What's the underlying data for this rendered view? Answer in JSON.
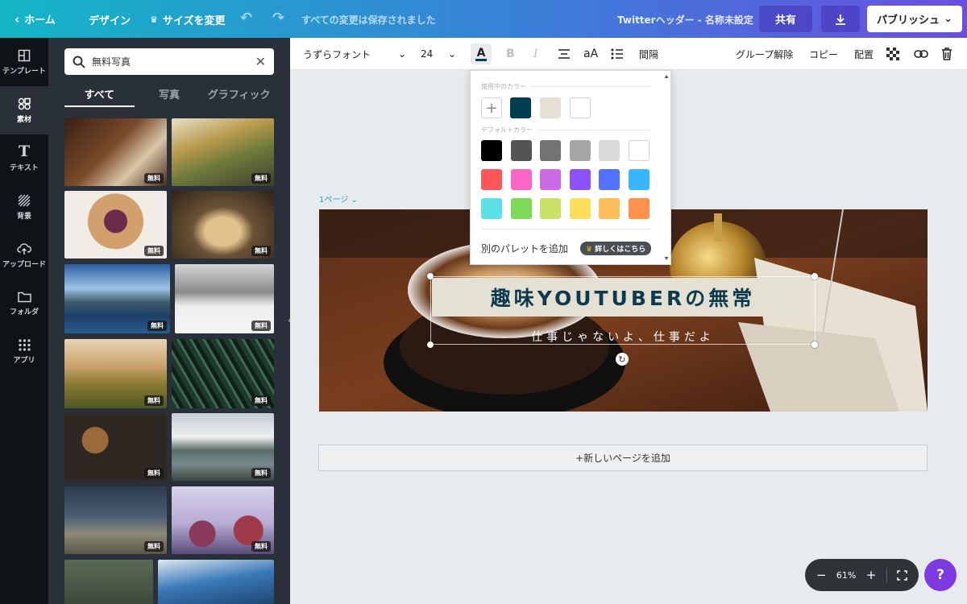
{
  "topbar": {
    "home_label": "ホーム",
    "design_label": "デザイン",
    "resize_label": "サイズを変更",
    "saved_status": "すべての変更は保存されました",
    "doc_title": "Twitterヘッダー - 名称未設定",
    "share_label": "共有",
    "publish_label": "パブリッシュ"
  },
  "rail": {
    "items": [
      {
        "label": "テンプレート",
        "icon": "layout-icon"
      },
      {
        "label": "素材",
        "icon": "shapes-icon"
      },
      {
        "label": "テキスト",
        "icon": "text-icon"
      },
      {
        "label": "背景",
        "icon": "background-icon"
      },
      {
        "label": "アップロード",
        "icon": "upload-icon"
      },
      {
        "label": "フォルダ",
        "icon": "folder-icon"
      },
      {
        "label": "アプリ",
        "icon": "apps-icon"
      }
    ]
  },
  "panel": {
    "search_value": "無料写真",
    "tabs": [
      "すべて",
      "写真",
      "グラフィック"
    ],
    "free_badge": "無料"
  },
  "toolbar": {
    "font_name": "うずらフォント",
    "font_size": "24",
    "case_label": "aA",
    "spacing_label": "間隔",
    "ungroup_label": "グループ解除",
    "copy_label": "コピー",
    "arrange_label": "配置"
  },
  "popover": {
    "in_use_heading": "使用中のカラー",
    "default_heading": "デフォルトカラー",
    "add_palette_label": "別のパレットを追加",
    "more_label": "詳しくはこちら",
    "in_use_colors": [
      "#003e52",
      "#e4e0d4",
      "#ffffff"
    ],
    "default_colors": [
      "#000000",
      "#545454",
      "#737373",
      "#a6a6a6",
      "#d9d9d9",
      "#ffffff",
      "#ff5757",
      "#ff66c4",
      "#cb6ce6",
      "#8c52ff",
      "#5271ff",
      "#38b6ff",
      "#5ce1e6",
      "#7ed957",
      "#c9e265",
      "#ffde59",
      "#ffbd59",
      "#ff914d"
    ]
  },
  "canvas": {
    "page_label": "1ページ",
    "headline": "趣味YOUTUBERの無常",
    "subline": "仕事じゃないよ、仕事だよ",
    "add_page_label": "+新しいページを追加"
  },
  "zoom": {
    "level": "61%",
    "help_label": "?"
  }
}
